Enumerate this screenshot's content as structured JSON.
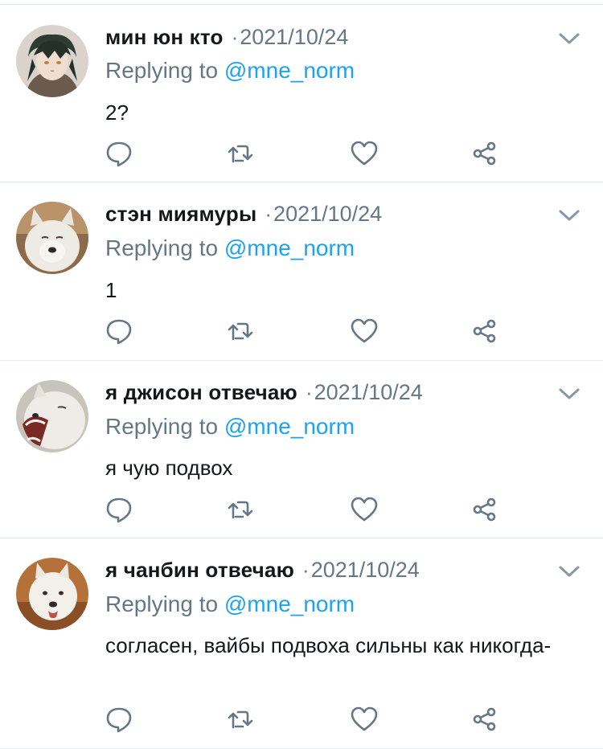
{
  "replies": [
    {
      "display_name": "мин юн кто",
      "separator": "·",
      "date": "2021/10/24",
      "replying_prefix": "Replying to",
      "replying_handle": "@mne_norm",
      "text": "2?",
      "avatar": "anime-character-avatar"
    },
    {
      "display_name": "стэн миямуры",
      "separator": "·",
      "date": "2021/10/24",
      "replying_prefix": "Replying to",
      "replying_handle": "@mne_norm",
      "text": "1",
      "avatar": "white-wolf-avatar"
    },
    {
      "display_name": "я джисон отвечаю",
      "separator": "·",
      "date": "2021/10/24",
      "replying_prefix": "Replying to",
      "replying_handle": "@mne_norm",
      "text": "я чую подвох",
      "avatar": "yawning-wolf-avatar"
    },
    {
      "display_name": "я чанбин отвечаю",
      "separator": "·",
      "date": "2021/10/24",
      "replying_prefix": "Replying to",
      "replying_handle": "@mne_norm",
      "text": "согласен, вайбы подвоха сильны как никогда-",
      "avatar": "white-wolf-autumn-avatar"
    }
  ],
  "icons": {
    "more": "chevron-down-icon",
    "reply": "reply-bubble-icon",
    "retweet": "retweet-icon",
    "like": "heart-icon",
    "share": "share-icon"
  },
  "colors": {
    "text": "#14171a",
    "secondary": "#657786",
    "link": "#1da1f2",
    "divider": "#e6ecf0"
  }
}
